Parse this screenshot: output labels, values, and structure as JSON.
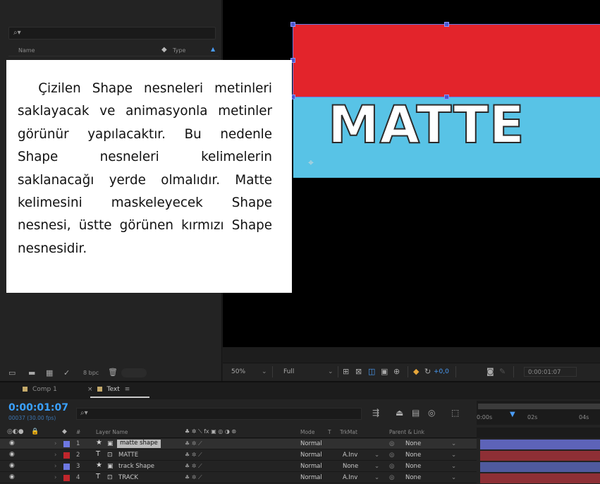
{
  "project": {
    "search_icon": "search-icon",
    "col_name": "Name",
    "col_type": "Type",
    "bpc": "8 bpc"
  },
  "overlay_text": "Çizilen Shape nesneleri metinleri saklayacak ve animasyonla metinler görünür yapılacaktır. Bu nedenle Shape nesneleri kelimelerin saklanacağı yerde olmalıdır.  Matte kelimesini maskeleyecek Shape nesnesi, üstte görünen kırmızı Shape nesnesidir.",
  "comp": {
    "word": "MATTE",
    "red": "#e3242b",
    "blue": "#58c3e6"
  },
  "viewer_bar": {
    "zoom": "50%",
    "resolution": "Full",
    "exposure": "+0,0",
    "timecode": "0:00:01:07"
  },
  "timeline": {
    "tabs": [
      {
        "label": "Comp 1",
        "color": "#c4a96a"
      },
      {
        "label": "Text",
        "color": "#c4a96a",
        "close": "×",
        "menu": "≡"
      }
    ],
    "timecode": "0:00:01:07",
    "fps": "00037 (30.00 fps)",
    "ruler": [
      "0:00s",
      "02s",
      "04s"
    ],
    "columns": {
      "hash": "#",
      "layer_name": "Layer Name",
      "mode": "Mode",
      "t": "T",
      "trkmat": "TrkMat",
      "parent": "Parent & Link"
    },
    "layers": [
      {
        "num": "1",
        "type_icon": "★",
        "name": "matte shape",
        "mode": "Normal",
        "trkmat": "",
        "parent": "None",
        "color": "#6e78e2",
        "bar": "#5d63b8",
        "selected": true
      },
      {
        "num": "2",
        "type_icon": "T",
        "name": "MATTE",
        "mode": "Normal",
        "trkmat": "A.Inv",
        "parent": "None",
        "color": "#c0262c",
        "bar": "#8e2f35",
        "selected": false
      },
      {
        "num": "3",
        "type_icon": "★",
        "name": "track Shape",
        "mode": "Normal",
        "trkmat": "None",
        "parent": "None",
        "color": "#6e78e2",
        "bar": "#4f5a9e",
        "selected": false
      },
      {
        "num": "4",
        "type_icon": "T",
        "name": "TRACK",
        "mode": "Normal",
        "trkmat": "A.Inv",
        "parent": "None",
        "color": "#c0262c",
        "bar": "#8e2f35",
        "selected": false
      }
    ]
  }
}
